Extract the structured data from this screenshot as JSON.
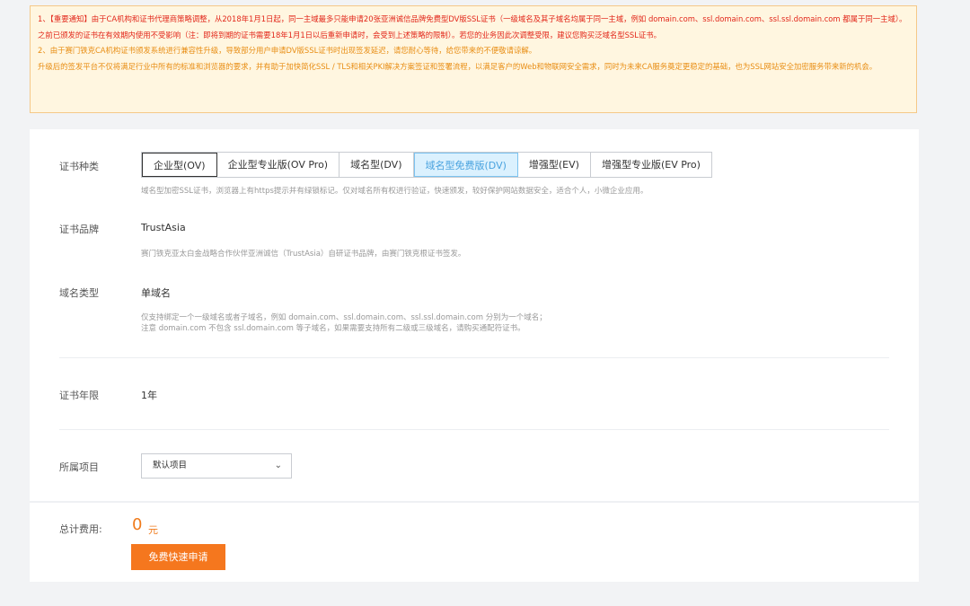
{
  "notice": {
    "line1": "1、【重要通知】由于CA机构和证书代理商策略调整，从2018年1月1日起，同一主域最多只能申请20张亚洲诚信品牌免费型DV版SSL证书（一级域名及其子域名均属于同一主域，例如 domain.com、ssl.domain.com、ssl.ssl.domain.com 都属于同一主域）。之前已颁发的证书在有效期内使用不受影响（注：即将到期的证书需要18年1月1日以后重新申请时，会受到上述策略的限制）。若您的业务因此次调整受限，建议您购买泛域名型SSL证书。",
    "line2": "2、由于赛门铁克CA机构证书颁发系统进行兼容性升级，导致部分用户申请DV版SSL证书时出现签发延迟，请您耐心等待，给您带来的不便敬请谅解。",
    "line3": "升级后的签发平台不仅将满足行业中所有的标准和浏览器的要求，并有助于加快简化SSL / TLS和相关PKI解决方案签证和签署流程，以满足客户的Web和物联网安全需求，同时为未来CA服务奠定更稳定的基础，也为SSL网站安全加密服务带来新的机会。"
  },
  "cert_type": {
    "label": "证书种类",
    "options": [
      "企业型(OV)",
      "企业型专业版(OV Pro)",
      "域名型(DV)",
      "域名型免费版(DV)",
      "增强型(EV)",
      "增强型专业版(EV Pro)"
    ],
    "selected": "域名型免费版(DV)",
    "desc": "域名型加密SSL证书，浏览器上有https提示并有绿锁标记。仅对域名所有权进行验证，快速颁发，较好保护网站数据安全，适合个人，小微企业应用。"
  },
  "brand": {
    "label": "证书品牌",
    "value": "TrustAsia",
    "desc": "赛门铁克亚太白金战略合作伙伴亚洲诚信（TrustAsia）自研证书品牌，由赛门铁克根证书签发。"
  },
  "domain_type": {
    "label": "域名类型",
    "value": "单域名",
    "desc1": "仅支持绑定一个一级域名或者子域名，例如 domain.com、ssl.domain.com、ssl.ssl.domain.com 分别为一个域名；",
    "desc2": "注意 domain.com 不包含 ssl.domain.com 等子域名，如果需要支持所有二级或三级域名，请购买通配符证书。"
  },
  "term": {
    "label": "证书年限",
    "value": "1年"
  },
  "project": {
    "label": "所属项目",
    "value": "默认项目"
  },
  "footer": {
    "total_label": "总计费用:",
    "amount": "0",
    "unit": "元",
    "apply_label": "免费快速申请"
  },
  "colors": {
    "accent": "#f5771e",
    "selected_bg": "#dbf1fe",
    "selected_text": "#4aa3df",
    "notice_red": "#e2271a",
    "notice_orange": "#e88d13"
  }
}
